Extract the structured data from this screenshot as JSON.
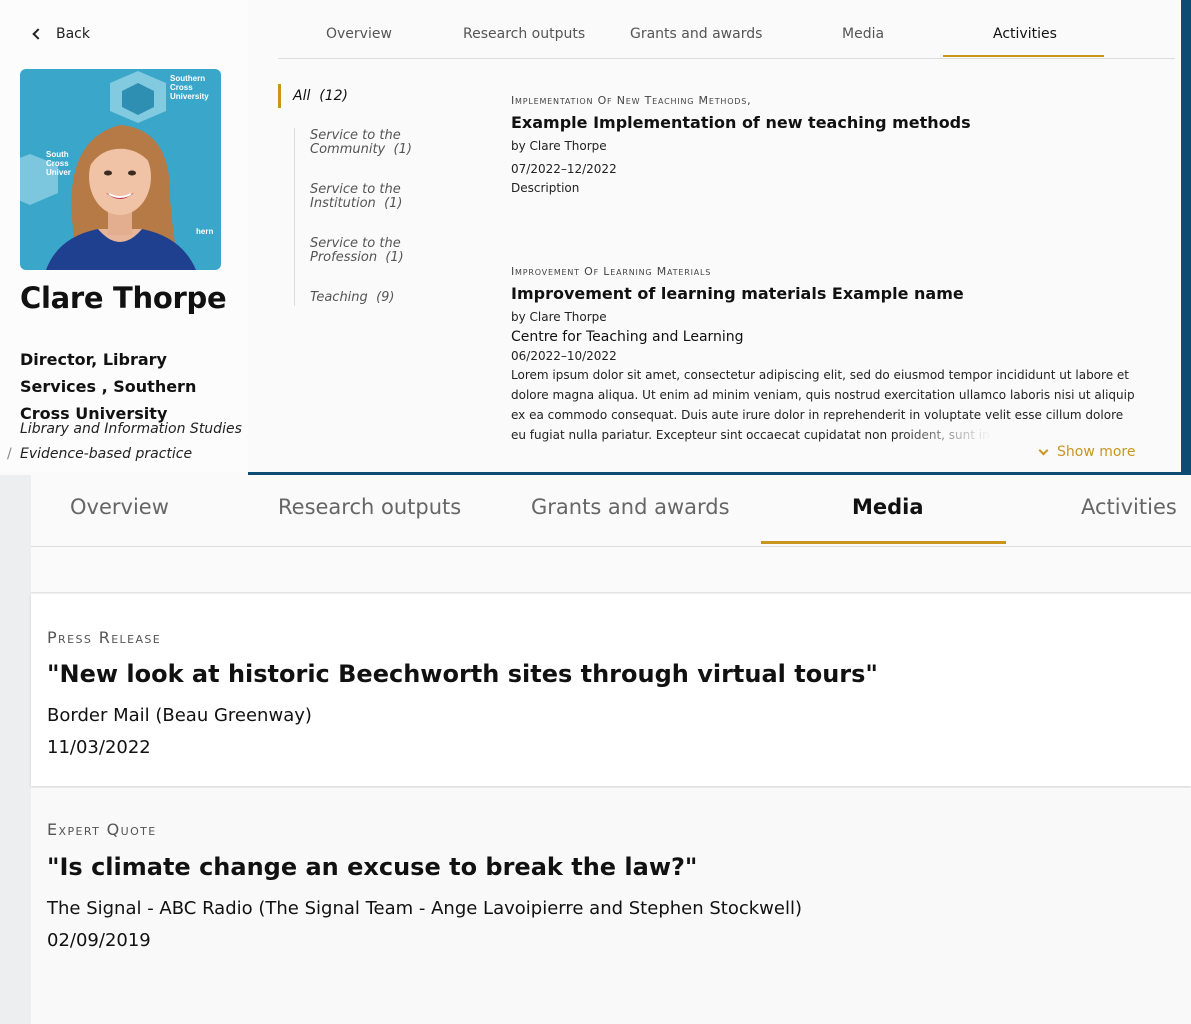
{
  "profile": {
    "back_label": "Back",
    "name": "Clare Thorpe",
    "role": "Director, Library Services , Southern Cross University",
    "tags": [
      "Library and Information Studies",
      "Evidence-based practice"
    ],
    "tag_separator": "/"
  },
  "top_tabs": [
    {
      "label": "Overview"
    },
    {
      "label": "Research outputs"
    },
    {
      "label": "Grants and awards"
    },
    {
      "label": "Media"
    },
    {
      "label": "Activities",
      "active": true
    }
  ],
  "filters": {
    "all": {
      "label": "All",
      "count": "(12)"
    },
    "items": [
      {
        "label": "Service to the Community",
        "count": "(1)"
      },
      {
        "label": "Service to the Institution",
        "count": "(1)"
      },
      {
        "label": "Service to the Profession",
        "count": "(1)"
      },
      {
        "label": "Teaching",
        "count": "(9)"
      }
    ]
  },
  "activities": [
    {
      "category": "Implementation Of New Teaching Methods,",
      "title": "Example Implementation of new teaching methods",
      "by": "by Clare Thorpe",
      "date": "07/2022–12/2022",
      "description": "Description"
    },
    {
      "category": "Improvement Of Learning Materials",
      "title": "Improvement of learning materials Example name",
      "by": "by Clare Thorpe",
      "org": "Centre for Teaching and Learning",
      "date": "06/2022–10/2022",
      "description": "Lorem ipsum dolor sit amet, consectetur adipiscing elit, sed do eiusmod tempor incididunt ut labore et dolore magna aliqua. Ut enim ad minim veniam, quis nostrud exercitation ullamco laboris nisi ut aliquip ex ea commodo consequat. Duis aute irure dolor in reprehenderit in voluptate velit esse cillum dolore eu fugiat nulla pariatur. Excepteur sint occaecat cupidatat non proident, sunt in culpa qui officia"
    }
  ],
  "show_more_label": "Show more",
  "bottom_tabs": [
    {
      "label": "Overview"
    },
    {
      "label": "Research outputs"
    },
    {
      "label": "Grants and awards"
    },
    {
      "label": "Media",
      "active": true
    },
    {
      "label": "Activities"
    }
  ],
  "media": [
    {
      "category": "Press Release",
      "title": "\"New look at historic Beechworth sites through virtual tours\"",
      "outlet": "Border Mail (Beau Greenway)",
      "date": "11/03/2022"
    },
    {
      "category": "Expert Quote",
      "title": "\"Is climate change an excuse to break the law?\"",
      "outlet": "The Signal - ABC Radio (The Signal Team - Ange Lavoipierre and Stephen Stockwell)",
      "date": "02/09/2019"
    }
  ],
  "colors": {
    "accent": "#c8961e",
    "navy": "#0d4b73",
    "photo_bg": "#3aa6c9",
    "logo_text": "Southern Cross University"
  }
}
